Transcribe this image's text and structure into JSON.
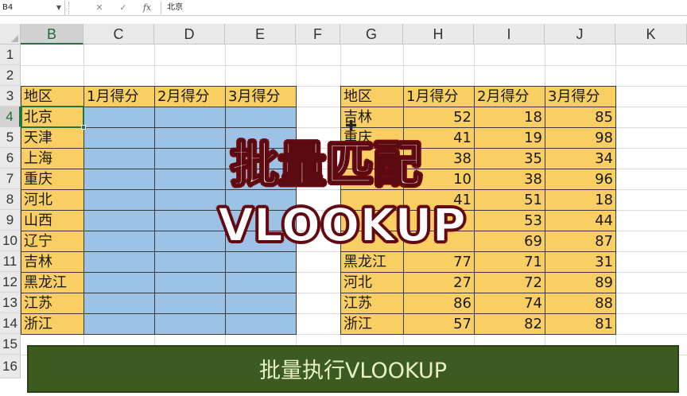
{
  "formula_bar": {
    "cell_ref": "B4",
    "buttons": [
      "✕",
      "✓",
      "fx"
    ],
    "content": "北京"
  },
  "columns": [
    "B",
    "C",
    "D",
    "E",
    "F",
    "G",
    "H",
    "I",
    "J",
    "K"
  ],
  "rows": [
    "1",
    "2",
    "3",
    "4",
    "5",
    "6",
    "7",
    "8",
    "9",
    "10",
    "11",
    "12",
    "13",
    "14",
    "15",
    "16"
  ],
  "left_table": {
    "headers": [
      "地区",
      "1月得分",
      "2月得分",
      "3月得分"
    ],
    "regions": [
      "北京",
      "天津",
      "上海",
      "重庆",
      "河北",
      "山西",
      "辽宁",
      "吉林",
      "黑龙江",
      "江苏",
      "浙江"
    ]
  },
  "right_table": {
    "headers": [
      "地区",
      "1月得分",
      "2月得分",
      "3月得分"
    ],
    "rows": [
      [
        "吉林",
        "52",
        "18",
        "85"
      ],
      [
        "重庆",
        "41",
        "19",
        "98"
      ],
      [
        "",
        "38",
        "35",
        "34"
      ],
      [
        "",
        "10",
        "38",
        "96"
      ],
      [
        "",
        "41",
        "51",
        "18"
      ],
      [
        "",
        "",
        "53",
        "44"
      ],
      [
        "",
        "",
        "69",
        "87"
      ],
      [
        "黑龙江",
        "77",
        "71",
        "31"
      ],
      [
        "河北",
        "27",
        "72",
        "89"
      ],
      [
        "江苏",
        "86",
        "74",
        "88"
      ],
      [
        "浙江",
        "57",
        "82",
        "81"
      ]
    ]
  },
  "overlay": {
    "title_cn": "批量匹配",
    "title_en": "VLOOKUP"
  },
  "banner": {
    "text": "批量执行VLOOKUP"
  },
  "colors": {
    "yellow_fill": "#f9ce62",
    "blue_fill": "#9cc3e6",
    "banner_bg": "#3c5c1f",
    "title_stroke": "#6b0a12"
  }
}
